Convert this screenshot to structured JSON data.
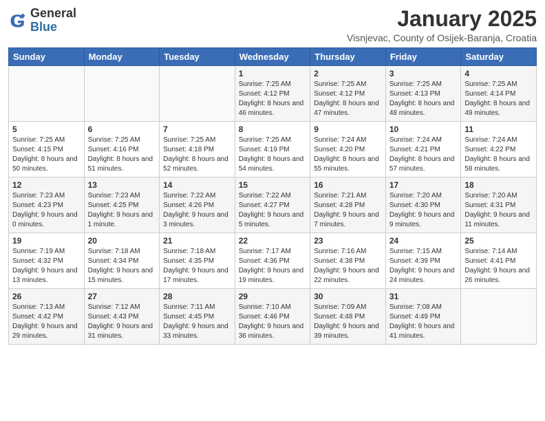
{
  "logo": {
    "general": "General",
    "blue": "Blue"
  },
  "title": "January 2025",
  "subtitle": "Visnjevac, County of Osijek-Baranja, Croatia",
  "weekdays": [
    "Sunday",
    "Monday",
    "Tuesday",
    "Wednesday",
    "Thursday",
    "Friday",
    "Saturday"
  ],
  "weeks": [
    [
      {
        "day": "",
        "sunrise": "",
        "sunset": "",
        "daylight": ""
      },
      {
        "day": "",
        "sunrise": "",
        "sunset": "",
        "daylight": ""
      },
      {
        "day": "",
        "sunrise": "",
        "sunset": "",
        "daylight": ""
      },
      {
        "day": "1",
        "sunrise": "Sunrise: 7:25 AM",
        "sunset": "Sunset: 4:12 PM",
        "daylight": "Daylight: 8 hours and 46 minutes."
      },
      {
        "day": "2",
        "sunrise": "Sunrise: 7:25 AM",
        "sunset": "Sunset: 4:12 PM",
        "daylight": "Daylight: 8 hours and 47 minutes."
      },
      {
        "day": "3",
        "sunrise": "Sunrise: 7:25 AM",
        "sunset": "Sunset: 4:13 PM",
        "daylight": "Daylight: 8 hours and 48 minutes."
      },
      {
        "day": "4",
        "sunrise": "Sunrise: 7:25 AM",
        "sunset": "Sunset: 4:14 PM",
        "daylight": "Daylight: 8 hours and 49 minutes."
      }
    ],
    [
      {
        "day": "5",
        "sunrise": "Sunrise: 7:25 AM",
        "sunset": "Sunset: 4:15 PM",
        "daylight": "Daylight: 8 hours and 50 minutes."
      },
      {
        "day": "6",
        "sunrise": "Sunrise: 7:25 AM",
        "sunset": "Sunset: 4:16 PM",
        "daylight": "Daylight: 8 hours and 51 minutes."
      },
      {
        "day": "7",
        "sunrise": "Sunrise: 7:25 AM",
        "sunset": "Sunset: 4:18 PM",
        "daylight": "Daylight: 8 hours and 52 minutes."
      },
      {
        "day": "8",
        "sunrise": "Sunrise: 7:25 AM",
        "sunset": "Sunset: 4:19 PM",
        "daylight": "Daylight: 8 hours and 54 minutes."
      },
      {
        "day": "9",
        "sunrise": "Sunrise: 7:24 AM",
        "sunset": "Sunset: 4:20 PM",
        "daylight": "Daylight: 8 hours and 55 minutes."
      },
      {
        "day": "10",
        "sunrise": "Sunrise: 7:24 AM",
        "sunset": "Sunset: 4:21 PM",
        "daylight": "Daylight: 8 hours and 57 minutes."
      },
      {
        "day": "11",
        "sunrise": "Sunrise: 7:24 AM",
        "sunset": "Sunset: 4:22 PM",
        "daylight": "Daylight: 8 hours and 58 minutes."
      }
    ],
    [
      {
        "day": "12",
        "sunrise": "Sunrise: 7:23 AM",
        "sunset": "Sunset: 4:23 PM",
        "daylight": "Daylight: 9 hours and 0 minutes."
      },
      {
        "day": "13",
        "sunrise": "Sunrise: 7:23 AM",
        "sunset": "Sunset: 4:25 PM",
        "daylight": "Daylight: 9 hours and 1 minute."
      },
      {
        "day": "14",
        "sunrise": "Sunrise: 7:22 AM",
        "sunset": "Sunset: 4:26 PM",
        "daylight": "Daylight: 9 hours and 3 minutes."
      },
      {
        "day": "15",
        "sunrise": "Sunrise: 7:22 AM",
        "sunset": "Sunset: 4:27 PM",
        "daylight": "Daylight: 9 hours and 5 minutes."
      },
      {
        "day": "16",
        "sunrise": "Sunrise: 7:21 AM",
        "sunset": "Sunset: 4:28 PM",
        "daylight": "Daylight: 9 hours and 7 minutes."
      },
      {
        "day": "17",
        "sunrise": "Sunrise: 7:20 AM",
        "sunset": "Sunset: 4:30 PM",
        "daylight": "Daylight: 9 hours and 9 minutes."
      },
      {
        "day": "18",
        "sunrise": "Sunrise: 7:20 AM",
        "sunset": "Sunset: 4:31 PM",
        "daylight": "Daylight: 9 hours and 11 minutes."
      }
    ],
    [
      {
        "day": "19",
        "sunrise": "Sunrise: 7:19 AM",
        "sunset": "Sunset: 4:32 PM",
        "daylight": "Daylight: 9 hours and 13 minutes."
      },
      {
        "day": "20",
        "sunrise": "Sunrise: 7:18 AM",
        "sunset": "Sunset: 4:34 PM",
        "daylight": "Daylight: 9 hours and 15 minutes."
      },
      {
        "day": "21",
        "sunrise": "Sunrise: 7:18 AM",
        "sunset": "Sunset: 4:35 PM",
        "daylight": "Daylight: 9 hours and 17 minutes."
      },
      {
        "day": "22",
        "sunrise": "Sunrise: 7:17 AM",
        "sunset": "Sunset: 4:36 PM",
        "daylight": "Daylight: 9 hours and 19 minutes."
      },
      {
        "day": "23",
        "sunrise": "Sunrise: 7:16 AM",
        "sunset": "Sunset: 4:38 PM",
        "daylight": "Daylight: 9 hours and 22 minutes."
      },
      {
        "day": "24",
        "sunrise": "Sunrise: 7:15 AM",
        "sunset": "Sunset: 4:39 PM",
        "daylight": "Daylight: 9 hours and 24 minutes."
      },
      {
        "day": "25",
        "sunrise": "Sunrise: 7:14 AM",
        "sunset": "Sunset: 4:41 PM",
        "daylight": "Daylight: 9 hours and 26 minutes."
      }
    ],
    [
      {
        "day": "26",
        "sunrise": "Sunrise: 7:13 AM",
        "sunset": "Sunset: 4:42 PM",
        "daylight": "Daylight: 9 hours and 29 minutes."
      },
      {
        "day": "27",
        "sunrise": "Sunrise: 7:12 AM",
        "sunset": "Sunset: 4:43 PM",
        "daylight": "Daylight: 9 hours and 31 minutes."
      },
      {
        "day": "28",
        "sunrise": "Sunrise: 7:11 AM",
        "sunset": "Sunset: 4:45 PM",
        "daylight": "Daylight: 9 hours and 33 minutes."
      },
      {
        "day": "29",
        "sunrise": "Sunrise: 7:10 AM",
        "sunset": "Sunset: 4:46 PM",
        "daylight": "Daylight: 9 hours and 36 minutes."
      },
      {
        "day": "30",
        "sunrise": "Sunrise: 7:09 AM",
        "sunset": "Sunset: 4:48 PM",
        "daylight": "Daylight: 9 hours and 39 minutes."
      },
      {
        "day": "31",
        "sunrise": "Sunrise: 7:08 AM",
        "sunset": "Sunset: 4:49 PM",
        "daylight": "Daylight: 9 hours and 41 minutes."
      },
      {
        "day": "",
        "sunrise": "",
        "sunset": "",
        "daylight": ""
      }
    ]
  ]
}
